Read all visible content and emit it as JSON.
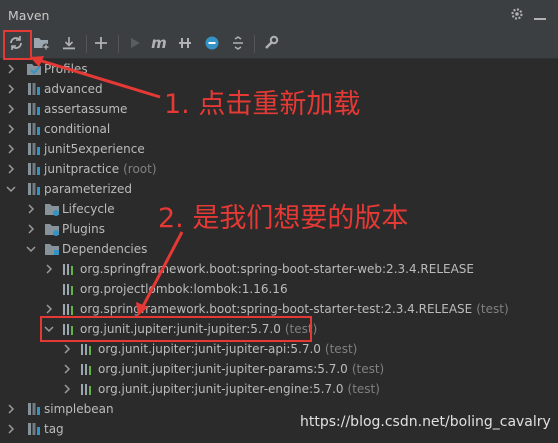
{
  "window": {
    "title": "Maven"
  },
  "toolbar": {
    "buttons": [
      "reload-icon",
      "add-folder-icon",
      "download-icon",
      "plus-icon",
      "run-icon",
      "maven-goal-icon",
      "toggle-offline-icon",
      "skip-tests-icon",
      "collapse-icon",
      "settings-wrench-icon"
    ],
    "maven_goal_glyph": "m"
  },
  "tree": {
    "profiles": "Profiles",
    "advanced": "advanced",
    "assertassume": "assertassume",
    "conditional": "conditional",
    "junit5experience": "junit5experience",
    "junitpractice": "junitpractice",
    "junitpractice_suffix": "(root)",
    "parameterized": "parameterized",
    "lifecycle": "Lifecycle",
    "plugins": "Plugins",
    "dependencies": "Dependencies",
    "dep_web": "org.springframework.boot:spring-boot-starter-web:2.3.4.RELEASE",
    "dep_lombok": "org.projectlombok:lombok:1.16.16",
    "dep_test": "org.springframework.boot:spring-boot-starter-test:2.3.4.RELEASE",
    "dep_test_scope": "(test)",
    "dep_jupiter": "org.junit.jupiter:junit-jupiter:5.7.0",
    "dep_jupiter_scope": "(test)",
    "dep_api": "org.junit.jupiter:junit-jupiter-api:5.7.0",
    "dep_api_scope": "(test)",
    "dep_params": "org.junit.jupiter:junit-jupiter-params:5.7.0",
    "dep_params_scope": "(test)",
    "dep_engine": "org.junit.jupiter:junit-jupiter-engine:5.7.0",
    "dep_engine_scope": "(test)",
    "simplebean": "simplebean",
    "tag": "tag"
  },
  "annotations": {
    "note1": "1. 点击重新加载",
    "note2": "2. 是我们想要的版本"
  },
  "watermark": "https://blog.csdn.net/boling_cavalry",
  "colors": {
    "annotation": "#e53935",
    "tree_bg": "#2b2b2b",
    "panel_bg": "#3c3f41"
  }
}
